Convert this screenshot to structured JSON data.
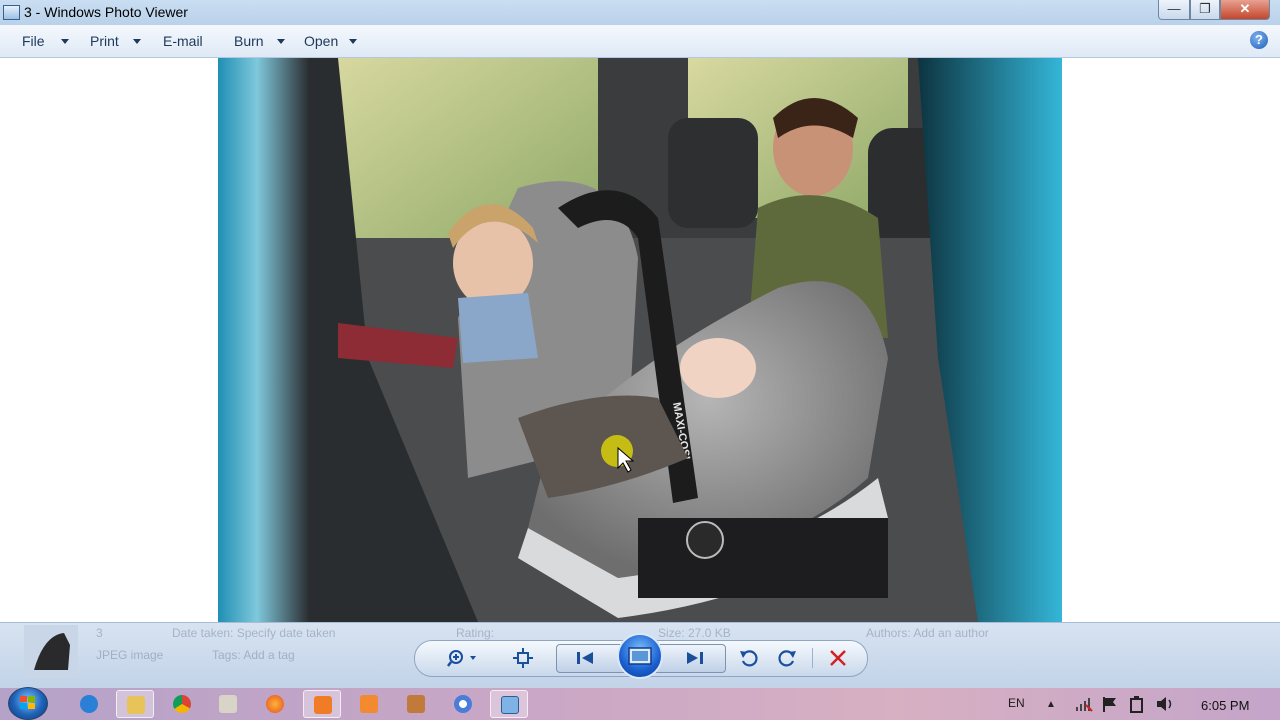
{
  "window": {
    "title": "3 - Windows Photo Viewer",
    "buttons": {
      "minimize": "—",
      "maximize": "❐",
      "close": "✕"
    }
  },
  "menu": {
    "items": [
      {
        "label": "File",
        "has_dropdown": true
      },
      {
        "label": "Print",
        "has_dropdown": true
      },
      {
        "label": "E-mail",
        "has_dropdown": false
      },
      {
        "label": "Burn",
        "has_dropdown": true
      },
      {
        "label": "Open",
        "has_dropdown": true
      }
    ],
    "help": "?"
  },
  "photo": {
    "description_icon": "car-seat-photo",
    "brand_on_seat": "MAXI-COSI"
  },
  "info_bar": {
    "file_name": "3",
    "file_type": "JPEG image",
    "date_taken": "Date taken: Specify date taken",
    "tags": "Tags: Add a tag",
    "rating": "Rating:",
    "size": "Size: 27.0 KB",
    "authors": "Authors: Add an author"
  },
  "controls": {
    "zoom_icon": "magnifier-icon",
    "fit_icon": "actual-size-icon",
    "prev_icon": "previous-icon",
    "slideshow_icon": "slideshow-icon",
    "next_icon": "next-icon",
    "rotate_ccw_icon": "rotate-counterclockwise-icon",
    "rotate_cw_icon": "rotate-clockwise-icon",
    "delete_icon": "delete-icon"
  },
  "taskbar": {
    "items": [
      "ie-icon",
      "explorer-icon",
      "chrome-icon",
      "media-icon",
      "firefox-icon",
      "app-orange-icon",
      "app-orange2-icon",
      "app-tools-icon",
      "chrome2-icon",
      "photo-viewer-icon"
    ],
    "language": "EN",
    "tray_up": "▲",
    "clock": "6:05 PM"
  },
  "colors": {
    "accent": "#1a5fd0",
    "titlebar": "#c9def2",
    "delete_red": "#d22020"
  }
}
